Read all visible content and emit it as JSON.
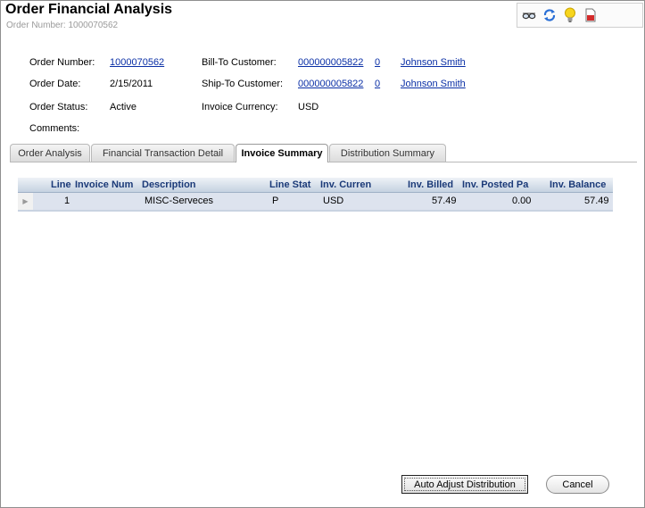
{
  "header": {
    "title": "Order Financial Analysis",
    "subtitle": "Order Number: 1000070562"
  },
  "toolbar": {
    "icons": [
      "glasses-icon",
      "refresh-icon",
      "lightbulb-icon",
      "pdf-report-icon"
    ]
  },
  "order": {
    "order_number_label": "Order Number:",
    "order_number": "1000070562",
    "order_date_label": "Order Date:",
    "order_date": "2/15/2011",
    "order_status_label": "Order Status:",
    "order_status": "Active",
    "comments_label": "Comments:",
    "bill_to_label": "Bill-To Customer:",
    "bill_to_id": "000000005822",
    "bill_to_sub": "0",
    "bill_to_name": "Johnson Smith",
    "ship_to_label": "Ship-To Customer:",
    "ship_to_id": "000000005822",
    "ship_to_sub": "0",
    "ship_to_name": "Johnson Smith",
    "currency_label": "Invoice Currency:",
    "currency": "USD"
  },
  "tabs": [
    {
      "label": "Order Analysis"
    },
    {
      "label": "Financial Transaction Detail"
    },
    {
      "label": "Invoice Summary"
    },
    {
      "label": "Distribution Summary"
    }
  ],
  "active_tab": 2,
  "grid": {
    "columns": [
      "Line",
      "Invoice Num",
      "Description",
      "Line Stat",
      "Inv. Curren",
      "Inv. Billed",
      "Inv. Posted Pa",
      "Inv. Balance"
    ],
    "rows": [
      {
        "line": "1",
        "invoice_num": "",
        "description": "MISC-Serveces",
        "line_stat": "P",
        "currency": "USD",
        "billed": "57.49",
        "posted": "0.00",
        "balance": "57.49"
      }
    ]
  },
  "buttons": {
    "auto_adjust": "Auto Adjust Distribution",
    "cancel": "Cancel"
  },
  "colors": {
    "link": "#0a2fa6",
    "grid_header_text": "#1b3a78",
    "grid_row_bg": "#dde3ee"
  }
}
